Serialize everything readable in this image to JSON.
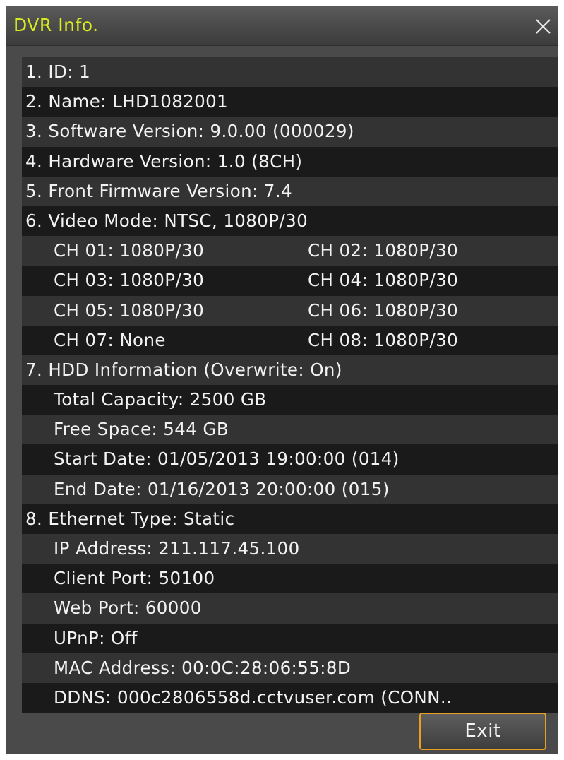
{
  "window": {
    "title": "DVR Info.",
    "close_icon": "close-icon"
  },
  "rows": [
    {
      "kind": "single",
      "level": 0,
      "text": "1. ID: 1"
    },
    {
      "kind": "single",
      "level": 0,
      "text": "2. Name: LHD1082001"
    },
    {
      "kind": "single",
      "level": 0,
      "text": "3. Software Version: 9.0.00 (000029)"
    },
    {
      "kind": "single",
      "level": 0,
      "text": "4. Hardware Version: 1.0 (8CH)"
    },
    {
      "kind": "single",
      "level": 0,
      "text": "5. Front Firmware Version: 7.4"
    },
    {
      "kind": "single",
      "level": 0,
      "text": "6. Video Mode: NTSC, 1080P/30"
    },
    {
      "kind": "pair",
      "level": 1,
      "left": "CH 01: 1080P/30",
      "right": "CH 02: 1080P/30"
    },
    {
      "kind": "pair",
      "level": 1,
      "left": "CH 03: 1080P/30",
      "right": "CH 04: 1080P/30"
    },
    {
      "kind": "pair",
      "level": 1,
      "left": "CH 05: 1080P/30",
      "right": "CH 06: 1080P/30"
    },
    {
      "kind": "pair",
      "level": 1,
      "left": "CH 07: None",
      "right": "CH 08: 1080P/30"
    },
    {
      "kind": "single",
      "level": 0,
      "text": "7. HDD Information  (Overwrite: On)"
    },
    {
      "kind": "single",
      "level": 1,
      "text": "Total Capacity: 2500 GB"
    },
    {
      "kind": "single",
      "level": 1,
      "text": "Free Space: 544 GB"
    },
    {
      "kind": "single",
      "level": 1,
      "text": "Start Date: 01/05/2013 19:00:00 (014)"
    },
    {
      "kind": "single",
      "level": 1,
      "text": "End Date: 01/16/2013 20:00:00 (015)"
    },
    {
      "kind": "single",
      "level": 0,
      "text": "8. Ethernet Type: Static"
    },
    {
      "kind": "single",
      "level": 1,
      "text": "IP Address: 211.117.45.100"
    },
    {
      "kind": "single",
      "level": 1,
      "text": "Client Port: 50100"
    },
    {
      "kind": "single",
      "level": 1,
      "text": "Web Port: 60000"
    },
    {
      "kind": "single",
      "level": 1,
      "text": "UPnP: Off"
    },
    {
      "kind": "single",
      "level": 1,
      "text": "MAC Address: 00:0C:28:06:55:8D"
    },
    {
      "kind": "single",
      "level": 1,
      "text": "DDNS: 000c2806558d.cctvuser.com (CONN.."
    }
  ],
  "buttons": {
    "exit_label": "Exit"
  },
  "colors": {
    "title_text": "#d8ec1e",
    "exit_border": "#e8a020",
    "row_light": "#333333",
    "row_dark": "#1a1a1a",
    "window_bg": "#4a4a4a"
  }
}
